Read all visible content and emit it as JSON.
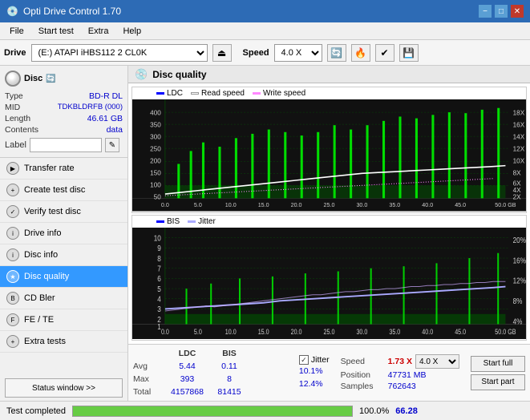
{
  "titlebar": {
    "title": "Opti Drive Control 1.70",
    "minimize": "−",
    "maximize": "□",
    "close": "✕"
  },
  "menubar": {
    "items": [
      "File",
      "Start test",
      "Extra",
      "Help"
    ]
  },
  "toolbar": {
    "drive_label": "Drive",
    "drive_value": "(E:)  ATAPI iHBS112  2 CL0K",
    "speed_label": "Speed",
    "speed_value": "4.0 X"
  },
  "disc": {
    "type_label": "Type",
    "type_value": "BD-R DL",
    "mid_label": "MID",
    "mid_value": "TDKBLDRFB (000)",
    "length_label": "Length",
    "length_value": "46.61 GB",
    "contents_label": "Contents",
    "contents_value": "data",
    "label_label": "Label",
    "label_value": ""
  },
  "sidebar": {
    "items": [
      {
        "label": "Transfer rate",
        "active": false
      },
      {
        "label": "Create test disc",
        "active": false
      },
      {
        "label": "Verify test disc",
        "active": false
      },
      {
        "label": "Drive info",
        "active": false
      },
      {
        "label": "Disc info",
        "active": false
      },
      {
        "label": "Disc quality",
        "active": true
      },
      {
        "label": "CD Bler",
        "active": false
      },
      {
        "label": "FE / TE",
        "active": false
      },
      {
        "label": "Extra tests",
        "active": false
      }
    ],
    "status_btn": "Status window >>"
  },
  "disc_quality": {
    "title": "Disc quality",
    "legend": {
      "ldc": "LDC",
      "read_speed": "Read speed",
      "write_speed": "Write speed",
      "bis": "BIS",
      "jitter": "Jitter"
    }
  },
  "stats": {
    "headers": [
      "",
      "LDC",
      "BIS",
      "",
      "Jitter",
      "Speed",
      ""
    ],
    "avg_label": "Avg",
    "avg_ldc": "5.44",
    "avg_bis": "0.11",
    "avg_jitter": "10.1%",
    "max_label": "Max",
    "max_ldc": "393",
    "max_bis": "8",
    "max_jitter": "12.4%",
    "total_label": "Total",
    "total_ldc": "4157868",
    "total_bis": "81415",
    "speed_label": "Speed",
    "speed_value": "1.73 X",
    "speed_select": "4.0 X",
    "position_label": "Position",
    "position_value": "47731 MB",
    "samples_label": "Samples",
    "samples_value": "762643",
    "start_full": "Start full",
    "start_part": "Start part"
  },
  "statusbar": {
    "text": "Test completed",
    "progress": 100,
    "pct": "100.0%",
    "speed": "66.28"
  },
  "chart1": {
    "y_max": 400,
    "y_labels": [
      "400",
      "350",
      "300",
      "250",
      "200",
      "150",
      "100",
      "50",
      "0"
    ],
    "y2_labels": [
      "18X",
      "16X",
      "14X",
      "12X",
      "10X",
      "8X",
      "6X",
      "4X",
      "2X"
    ],
    "x_labels": [
      "0.0",
      "5.0",
      "10.0",
      "15.0",
      "20.0",
      "25.0",
      "30.0",
      "35.0",
      "40.0",
      "45.0",
      "50.0 GB"
    ]
  },
  "chart2": {
    "y_max": 10,
    "y_labels": [
      "10",
      "9",
      "8",
      "7",
      "6",
      "5",
      "4",
      "3",
      "2",
      "1"
    ],
    "y2_labels": [
      "20%",
      "16%",
      "12%",
      "8%",
      "4%"
    ],
    "x_labels": [
      "0.0",
      "5.0",
      "10.0",
      "15.0",
      "20.0",
      "25.0",
      "30.0",
      "35.0",
      "40.0",
      "45.0",
      "50.0 GB"
    ]
  }
}
